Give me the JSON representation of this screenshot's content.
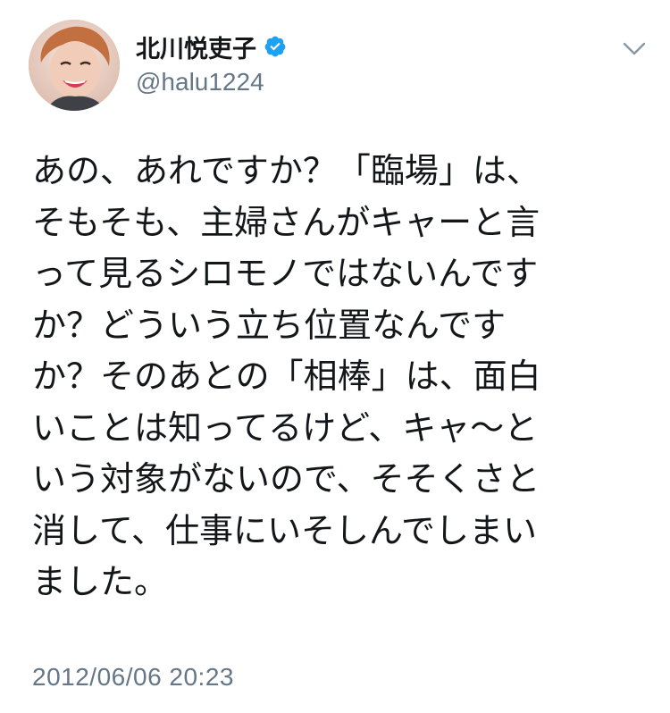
{
  "user": {
    "display_name": "北川悦吏子",
    "handle": "@halu1224",
    "verified": true,
    "avatar_icon": "profile-avatar"
  },
  "tweet": {
    "text": "あの、あれですか？「臨場」は、\nそもそも、主婦さんがキャーと言\nって見るシロモノではないんです\nか？どういう立ち位置なんです\nか？そのあとの「相棒」は、面白\nいことは知ってるけど、キャ〜と\nいう対象がないので、そそくさと\n消して、仕事にいそしんでしまい\nました。",
    "timestamp": "2012/06/06 20:23"
  },
  "icons": {
    "verified": "verified-badge-icon",
    "menu": "chevron-down-icon"
  },
  "colors": {
    "text": "#14171a",
    "secondary": "#657786",
    "verified": "#1da1f2",
    "background": "#ffffff"
  }
}
